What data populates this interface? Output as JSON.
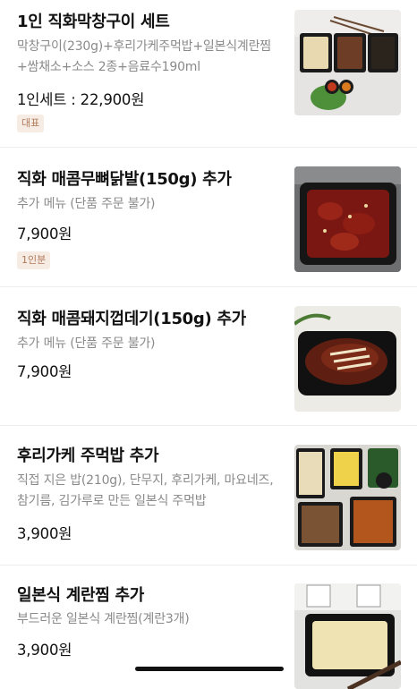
{
  "menu": {
    "items": [
      {
        "title": "1인 직화막창구이 세트",
        "desc": "막창구이(230g)+후리가케주먹밥+일본식계란찜+쌈채소+소스 2종+음료수190ml",
        "price": "1인세트 : 22,900원",
        "badge": "대표",
        "image_icon": "makchang-set-photo"
      },
      {
        "title": "직화 매콤무뼈닭발(150g) 추가",
        "desc": "추가 메뉴 (단품 주문 불가)",
        "price": "7,900원",
        "badge": "1인분",
        "image_icon": "spicy-chicken-feet-photo"
      },
      {
        "title": "직화 매콤돼지껍데기(150g) 추가",
        "desc": "추가 메뉴 (단품 주문 불가)",
        "price": "7,900원",
        "image_icon": "spicy-pork-skin-photo"
      },
      {
        "title": "후리가케 주먹밥 추가",
        "desc": "직접 지은 밥(210g), 단무지, 후리가케, 마요네즈, 참기름, 김가루로 만든 일본식 주먹밥",
        "price": "3,900원",
        "image_icon": "rice-ball-photo"
      },
      {
        "title": "일본식 계란찜 추가",
        "desc": "부드러운 일본식 계란찜(계란3개)",
        "price": "3,900원",
        "image_icon": "steamed-egg-photo"
      }
    ]
  },
  "colors": {
    "badge_bg": "#f6ece4",
    "badge_text": "#b07a5a",
    "desc_text": "#8a8a8a",
    "divider": "#eeeeee"
  }
}
